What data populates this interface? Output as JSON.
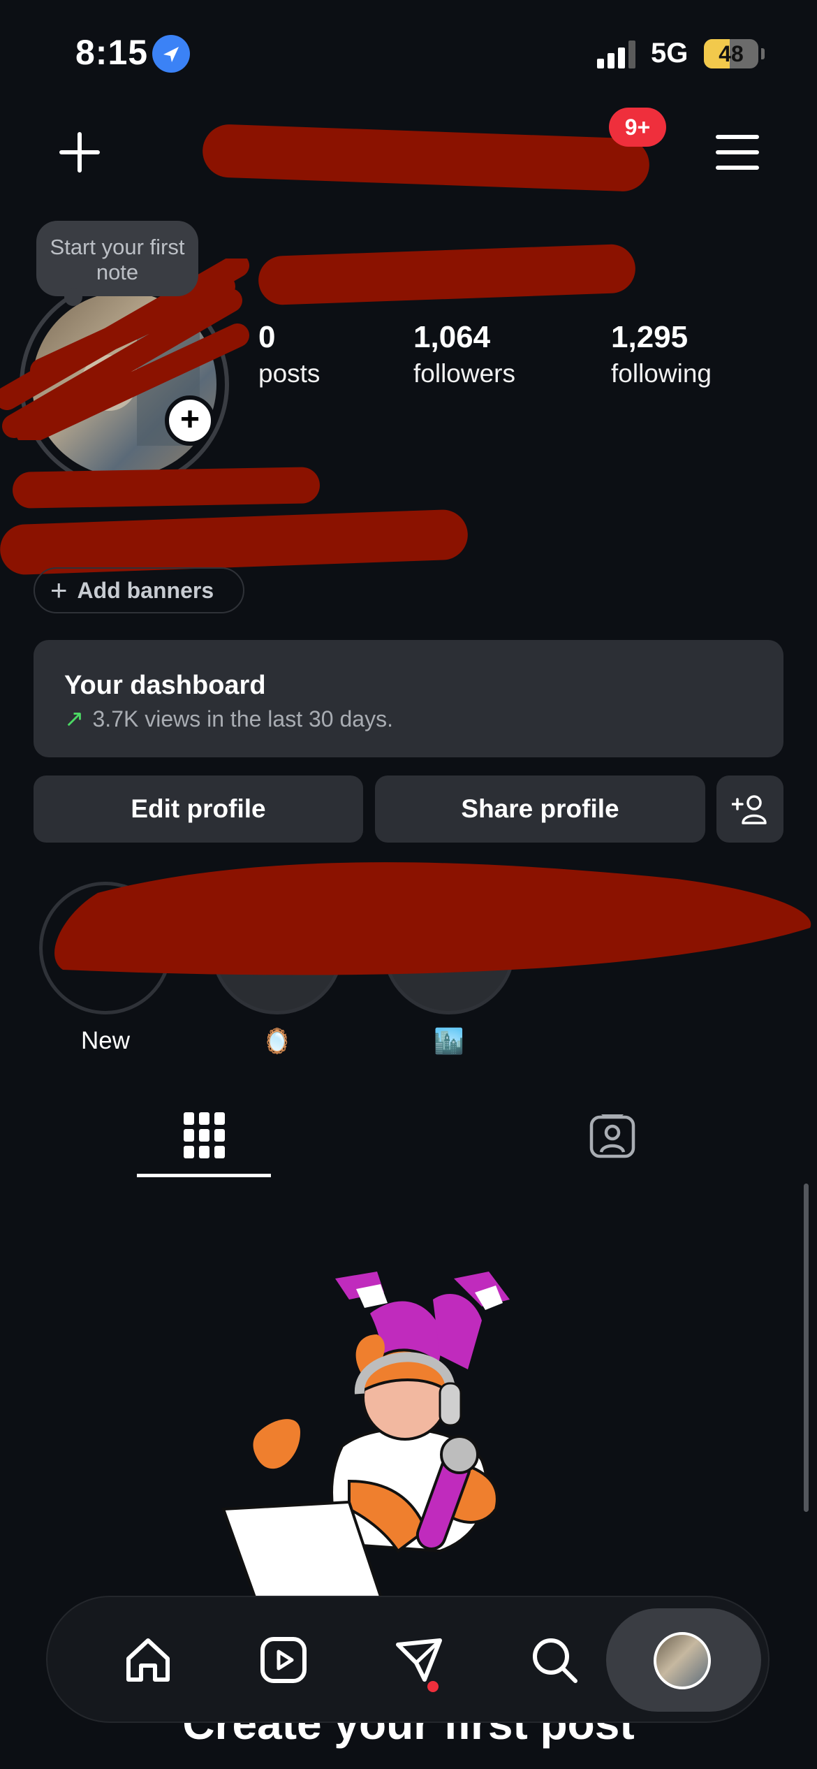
{
  "status_bar": {
    "time": "8:15",
    "network": "5G",
    "battery_percent": "48",
    "battery_level": 0.48,
    "location_icon": "location-arrow-icon",
    "signal_icon": "cellular-signal-icon"
  },
  "header": {
    "create_icon": "plus-icon",
    "threads_icon": "threads-icon",
    "threads_badge": "9+",
    "menu_icon": "hamburger-menu-icon"
  },
  "profile": {
    "note_bubble": "Start your first note",
    "stats": [
      {
        "value": "0",
        "label": "posts"
      },
      {
        "value": "1,064",
        "label": "followers"
      },
      {
        "value": "1,295",
        "label": "following"
      }
    ],
    "add_banners_label": "Add banners"
  },
  "dashboard": {
    "title": "Your dashboard",
    "subtitle": "3.7K views in the last 30 days."
  },
  "actions": {
    "edit_profile": "Edit profile",
    "share_profile": "Share profile",
    "discover_people_icon": "add-person-icon"
  },
  "highlights": [
    {
      "label": "New"
    },
    {
      "label": "🪞"
    },
    {
      "label": "🏙️"
    }
  ],
  "tabs": {
    "grid_icon": "grid-icon",
    "tagged_icon": "tagged-person-icon"
  },
  "empty_state": {
    "title": "Create your first post"
  },
  "bottom_nav": {
    "items": [
      "home-icon",
      "reels-icon",
      "direct-messages-icon",
      "search-icon",
      "profile-avatar"
    ]
  },
  "colors": {
    "background": "#0c0f14",
    "surface": "#2c2f35",
    "badge_red": "#ef2f3c",
    "trend_green": "#4cd964",
    "redaction": "#8b1200"
  }
}
